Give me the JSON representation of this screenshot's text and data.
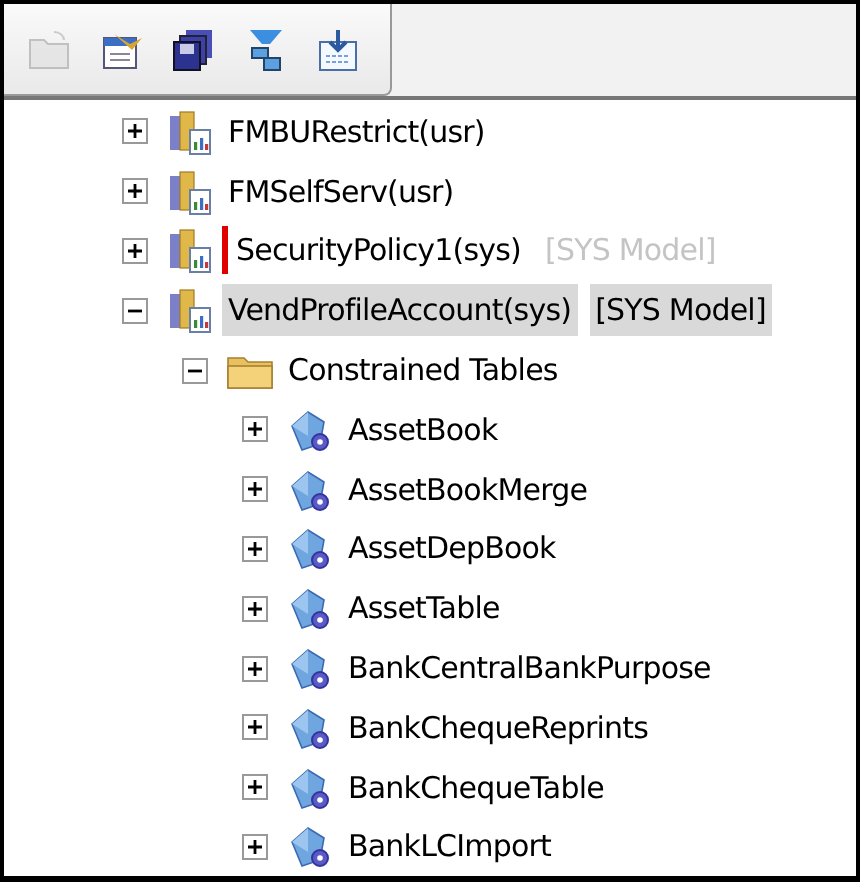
{
  "toolbar": {
    "buttons": [
      {
        "kind": "open",
        "disabled": true
      },
      {
        "kind": "properties",
        "disabled": false
      },
      {
        "kind": "save",
        "disabled": false
      },
      {
        "kind": "filter",
        "disabled": false
      },
      {
        "kind": "import",
        "disabled": false
      }
    ]
  },
  "tree": [
    {
      "kind": "project",
      "label": "FMBURestrict(usr)",
      "expanded": false,
      "selected": false,
      "modified": false
    },
    {
      "kind": "project",
      "label": "FMSelfServ(usr)",
      "expanded": false,
      "selected": false,
      "modified": false
    },
    {
      "kind": "project",
      "label": "SecurityPolicy1(sys)",
      "model": "[SYS Model]",
      "expanded": false,
      "selected": false,
      "modified": true
    },
    {
      "kind": "project",
      "label": "VendProfileAccount(sys)",
      "model": "[SYS Model]",
      "expanded": true,
      "selected": true,
      "modified": false,
      "children": [
        {
          "kind": "folder",
          "label": "Constrained Tables",
          "expanded": true,
          "selected": false,
          "modified": false,
          "children": [
            {
              "kind": "table",
              "label": "AssetBook",
              "expanded": false,
              "selected": false,
              "modified": false
            },
            {
              "kind": "table",
              "label": "AssetBookMerge",
              "expanded": false,
              "selected": false,
              "modified": false
            },
            {
              "kind": "table",
              "label": "AssetDepBook",
              "expanded": false,
              "selected": false,
              "modified": false
            },
            {
              "kind": "table",
              "label": "AssetTable",
              "expanded": false,
              "selected": false,
              "modified": false
            },
            {
              "kind": "table",
              "label": "BankCentralBankPurpose",
              "expanded": false,
              "selected": false,
              "modified": false
            },
            {
              "kind": "table",
              "label": "BankChequeReprints",
              "expanded": false,
              "selected": false,
              "modified": false
            },
            {
              "kind": "table",
              "label": "BankChequeTable",
              "expanded": false,
              "selected": false,
              "modified": false
            },
            {
              "kind": "table",
              "label": "BankLCImport",
              "expanded": false,
              "selected": false,
              "modified": false
            }
          ]
        }
      ]
    }
  ]
}
